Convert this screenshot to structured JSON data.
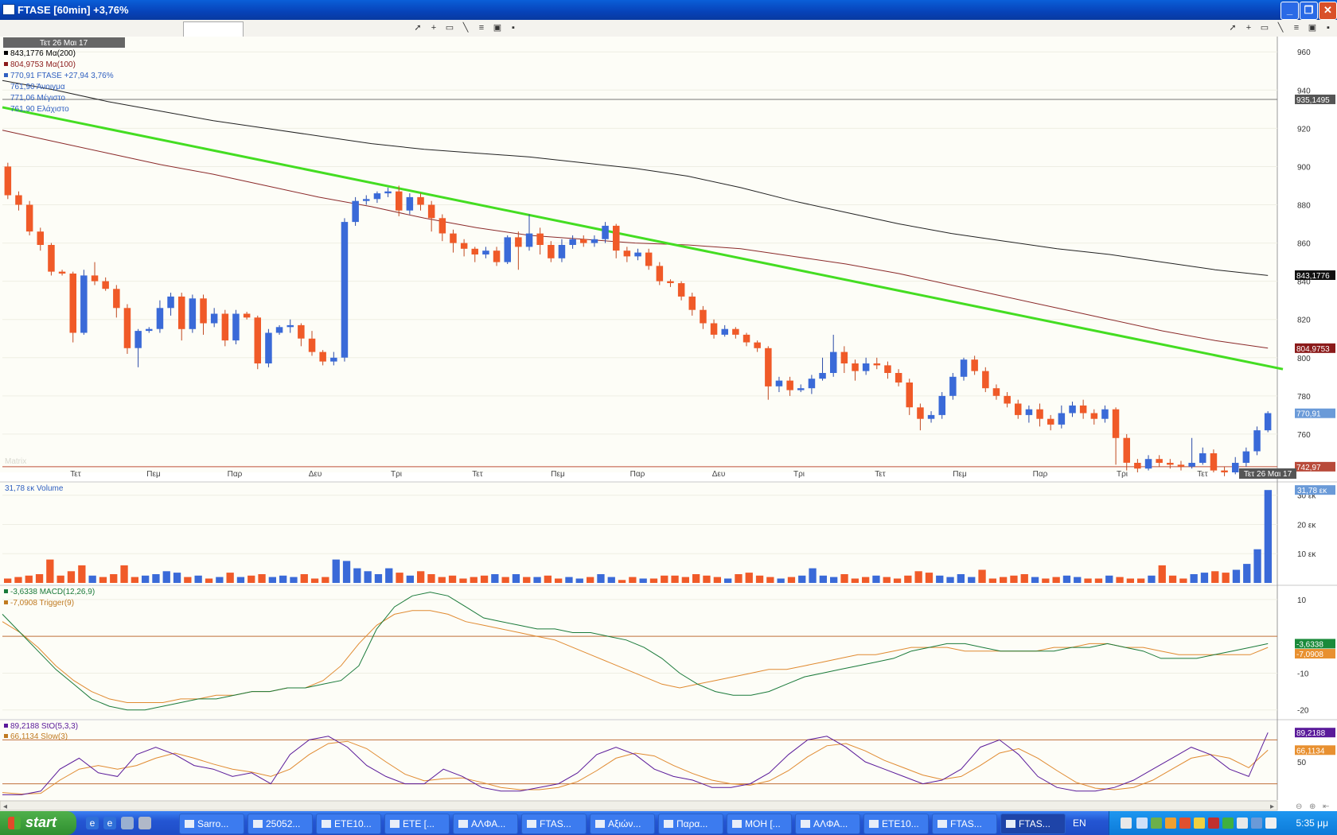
{
  "window": {
    "title": "FTASE [60min] +3,76%",
    "buttons": {
      "minimize": "_",
      "restore": "❐",
      "close": "✕"
    }
  },
  "toolbar": {
    "input_value": ""
  },
  "price_panel": {
    "date_label": "Τετ 26 Μαι 17",
    "legend": [
      {
        "text": "843,1776 Μα(200)",
        "color": "#000000"
      },
      {
        "text": "804,9753 Μα(100)",
        "color": "#8b1a1a"
      },
      {
        "text": "770,91 FTASE +27,94 3,76%",
        "color": "#3060c0"
      },
      {
        "text": "761,90 Άνοιγμα",
        "color": "#3060c0"
      },
      {
        "text": "771,06 Μέγιστο",
        "color": "#3060c0"
      },
      {
        "text": "761,90 Ελάχιστο",
        "color": "#3060c0"
      }
    ],
    "watermark": "Matrix"
  },
  "volume_panel": {
    "legend": "31,78 εκ Volume",
    "badge": "31,78 εκ"
  },
  "macd_panel": {
    "legend": [
      {
        "text": "-3,6338 MACD(12,26,9)",
        "color": "#1a7a3a"
      },
      {
        "text": "-7,0908 Trigger(9)",
        "color": "#c07a20"
      }
    ],
    "badges": [
      "-3,6338",
      "-7,0908"
    ]
  },
  "stoch_panel": {
    "legend": [
      {
        "text": "89,2188 StO(5,3,3)",
        "color": "#5a1a9a"
      },
      {
        "text": "66,1134 Slow(3)",
        "color": "#c07a20"
      }
    ],
    "badges": [
      "89,2188",
      "66,1134"
    ]
  },
  "chart_data": [
    {
      "type": "candlestick",
      "name": "FTASE [60min]",
      "x_ticks": [
        "Τετ",
        "Πεμ",
        "Παρ",
        "Δευ",
        "Τρι",
        "Τετ",
        "Πεμ",
        "Παρ",
        "Δευ",
        "Τρι",
        "Τετ",
        "Πεμ",
        "Παρ",
        "Τρι",
        "Τετ",
        "Τετ 26 Μαι 17"
      ],
      "y_ticks": [
        760,
        780,
        800,
        820,
        840,
        860,
        880,
        900,
        920,
        940,
        960
      ],
      "ylim": [
        740,
        968
      ],
      "price_badges": [
        {
          "text": "935,1495",
          "value": 935.15,
          "bg": "#555555",
          "fg": "#ffffff"
        },
        {
          "text": "843,1776",
          "value": 843.18,
          "bg": "#111111",
          "fg": "#ffffff"
        },
        {
          "text": "804,9753",
          "value": 804.98,
          "bg": "#8b1a1a",
          "fg": "#ffffff"
        },
        {
          "text": "770,91",
          "value": 770.91,
          "bg": "#6a9ad8",
          "fg": "#ffffff"
        },
        {
          "text": "742,97",
          "value": 742.97,
          "bg": "#b84a3a",
          "fg": "#ffffff"
        }
      ],
      "horizontal_lines": [
        935.15,
        742.97
      ],
      "trendline": {
        "color": "#44dd22",
        "from": 931,
        "to": 794
      },
      "ma200": [
        945,
        940,
        934,
        929,
        924,
        920,
        916,
        912,
        909,
        907,
        905,
        902,
        899,
        895,
        889,
        882,
        876,
        870,
        865,
        861,
        857,
        854,
        850,
        846,
        843
      ],
      "ma100": [
        919,
        913,
        907,
        901,
        896,
        890,
        884,
        879,
        873,
        868,
        864,
        862,
        860,
        859,
        857,
        853,
        849,
        844,
        838,
        832,
        826,
        820,
        814,
        809,
        805
      ],
      "candles": [
        [
          900,
          885,
          902,
          883
        ],
        [
          885,
          880,
          887,
          877
        ],
        [
          880,
          866,
          882,
          864
        ],
        [
          866,
          859,
          868,
          856
        ],
        [
          859,
          845,
          860,
          843
        ],
        [
          845,
          844,
          846,
          843
        ],
        [
          844,
          813,
          845,
          808
        ],
        [
          813,
          843,
          846,
          812
        ],
        [
          843,
          840,
          850,
          838
        ],
        [
          840,
          836,
          842,
          835
        ],
        [
          836,
          826,
          838,
          821
        ],
        [
          826,
          805,
          828,
          802
        ],
        [
          805,
          814,
          815,
          795
        ],
        [
          814,
          815,
          816,
          813
        ],
        [
          815,
          826,
          830,
          813
        ],
        [
          826,
          832,
          834,
          822
        ],
        [
          832,
          815,
          834,
          809
        ],
        [
          815,
          831,
          833,
          813
        ],
        [
          831,
          818,
          833,
          812
        ],
        [
          818,
          823,
          826,
          816
        ],
        [
          823,
          809,
          825,
          806
        ],
        [
          809,
          823,
          825,
          807
        ],
        [
          823,
          821,
          824,
          820
        ],
        [
          821,
          797,
          822,
          794
        ],
        [
          797,
          813,
          815,
          795
        ],
        [
          813,
          816,
          817,
          812
        ],
        [
          816,
          817,
          820,
          813
        ],
        [
          817,
          810,
          818,
          806
        ],
        [
          810,
          803,
          814,
          801
        ],
        [
          803,
          798,
          804,
          796
        ],
        [
          798,
          800,
          803,
          796
        ],
        [
          800,
          871,
          873,
          798
        ],
        [
          871,
          882,
          884,
          869
        ],
        [
          882,
          883,
          885,
          880
        ],
        [
          883,
          886,
          887,
          881
        ],
        [
          886,
          887,
          889,
          884
        ],
        [
          887,
          877,
          890,
          874
        ],
        [
          877,
          884,
          886,
          875
        ],
        [
          884,
          880,
          886,
          877
        ],
        [
          880,
          873,
          882,
          866
        ],
        [
          873,
          865,
          875,
          861
        ],
        [
          865,
          860,
          867,
          855
        ],
        [
          860,
          857,
          862,
          853
        ],
        [
          857,
          854,
          858,
          850
        ],
        [
          854,
          856,
          858,
          852
        ],
        [
          856,
          850,
          858,
          848
        ],
        [
          850,
          863,
          864,
          849
        ],
        [
          863,
          858,
          866,
          846
        ],
        [
          858,
          865,
          875,
          856
        ],
        [
          865,
          859,
          868,
          854
        ],
        [
          859,
          852,
          861,
          850
        ],
        [
          852,
          859,
          862,
          850
        ],
        [
          859,
          862,
          864,
          857
        ],
        [
          862,
          860,
          864,
          858
        ],
        [
          860,
          862,
          864,
          858
        ],
        [
          862,
          869,
          871,
          860
        ],
        [
          869,
          856,
          870,
          852
        ],
        [
          856,
          853,
          858,
          850
        ],
        [
          853,
          855,
          857,
          851
        ],
        [
          855,
          848,
          857,
          846
        ],
        [
          848,
          840,
          850,
          838
        ],
        [
          840,
          839,
          841,
          837
        ],
        [
          839,
          832,
          840,
          830
        ],
        [
          832,
          825,
          834,
          822
        ],
        [
          825,
          818,
          827,
          815
        ],
        [
          818,
          812,
          820,
          810
        ],
        [
          812,
          815,
          817,
          811
        ],
        [
          815,
          812,
          816,
          810
        ],
        [
          812,
          808,
          813,
          806
        ],
        [
          808,
          805,
          809,
          803
        ],
        [
          805,
          785,
          806,
          778
        ],
        [
          785,
          788,
          790,
          782
        ],
        [
          788,
          783,
          790,
          780
        ],
        [
          783,
          784,
          786,
          782
        ],
        [
          784,
          789,
          791,
          781
        ],
        [
          789,
          792,
          800,
          788
        ],
        [
          792,
          803,
          812,
          790
        ],
        [
          803,
          797,
          806,
          792
        ],
        [
          797,
          793,
          799,
          788
        ],
        [
          793,
          797,
          800,
          791
        ],
        [
          797,
          796,
          800,
          794
        ],
        [
          796,
          792,
          798,
          789
        ],
        [
          792,
          787,
          794,
          785
        ],
        [
          787,
          774,
          789,
          770
        ],
        [
          774,
          768,
          776,
          762
        ],
        [
          768,
          770,
          772,
          766
        ],
        [
          770,
          780,
          782,
          768
        ],
        [
          780,
          790,
          792,
          778
        ],
        [
          790,
          799,
          800,
          788
        ],
        [
          799,
          793,
          801,
          791
        ],
        [
          793,
          784,
          795,
          782
        ],
        [
          784,
          780,
          786,
          778
        ],
        [
          780,
          776,
          782,
          774
        ],
        [
          776,
          770,
          778,
          768
        ],
        [
          770,
          773,
          775,
          766
        ],
        [
          773,
          768,
          776,
          764
        ],
        [
          768,
          765,
          770,
          762
        ],
        [
          765,
          771,
          775,
          763
        ],
        [
          771,
          775,
          777,
          769
        ],
        [
          775,
          771,
          778,
          768
        ],
        [
          771,
          768,
          773,
          765
        ],
        [
          768,
          773,
          775,
          766
        ],
        [
          773,
          758,
          774,
          744
        ],
        [
          758,
          745,
          760,
          741
        ],
        [
          745,
          742,
          747,
          740
        ],
        [
          742,
          747,
          749,
          741
        ],
        [
          747,
          745,
          749,
          743
        ],
        [
          745,
          744,
          747,
          742
        ],
        [
          744,
          743,
          746,
          741
        ],
        [
          743,
          745,
          758,
          742
        ],
        [
          745,
          750,
          753,
          744
        ],
        [
          750,
          741,
          752,
          740
        ],
        [
          741,
          740,
          743,
          738
        ],
        [
          740,
          745,
          748,
          739
        ],
        [
          745,
          751,
          753,
          743
        ],
        [
          751,
          762,
          764,
          749
        ],
        [
          762,
          771,
          772,
          761
        ]
      ],
      "volume_ylim": [
        0,
        34
      ],
      "volume_ticks": [
        "10 εκ",
        "20 εκ",
        "30 εκ"
      ],
      "volume_values": [
        1.5,
        2,
        2.5,
        3,
        8,
        2.5,
        4,
        6,
        2.5,
        2,
        3,
        6,
        2,
        2.5,
        3,
        4,
        3.5,
        2,
        2.5,
        1.5,
        2,
        3.5,
        2,
        2.5,
        3,
        2,
        2.5,
        2,
        3,
        1.5,
        2,
        8,
        7.5,
        5,
        4,
        3,
        5,
        3.5,
        2.5,
        4,
        3,
        2,
        2.5,
        1.5,
        2,
        2.5,
        3,
        2,
        3,
        2,
        2,
        2.5,
        1.5,
        2,
        1.5,
        2,
        3,
        2,
        1,
        2,
        1.5,
        1.5,
        2.5,
        2.5,
        2,
        3,
        2.5,
        2,
        1.5,
        3,
        3.5,
        2.5,
        2,
        1.5,
        2,
        2.5,
        5,
        2.5,
        2,
        3,
        1.5,
        2,
        2.5,
        2,
        1.5,
        2.5,
        4,
        3.5,
        2.5,
        2,
        3,
        2,
        4.5,
        1.5,
        2,
        2.5,
        3,
        2,
        1.5,
        2,
        2.5,
        2,
        1.5,
        1.5,
        2.5,
        2,
        1.5,
        1.5,
        2.5,
        6,
        2.5,
        1.5,
        3,
        3.5,
        4,
        3.5,
        4.5,
        6.5,
        11.5,
        31.78
      ],
      "macd_ylim": [
        -22,
        13
      ],
      "macd_ticks": [
        10,
        -10,
        -20
      ],
      "macd_refline": 0,
      "macd": [
        6,
        1,
        -4,
        -9,
        -13,
        -17,
        -19,
        -20,
        -20,
        -19,
        -18,
        -17,
        -17,
        -16,
        -15,
        -15,
        -14,
        -14,
        -13,
        -12,
        -8,
        2,
        8,
        11,
        12,
        11,
        8,
        5,
        4,
        3,
        2,
        2,
        1,
        1,
        0,
        -1,
        -3,
        -6,
        -10,
        -13,
        -15,
        -16,
        -16,
        -15,
        -13,
        -11,
        -10,
        -9,
        -8,
        -7,
        -6,
        -4,
        -3,
        -2,
        -2,
        -3,
        -4,
        -4,
        -4,
        -4,
        -3,
        -3,
        -2,
        -3,
        -4,
        -6,
        -6,
        -6,
        -5,
        -4,
        -3,
        -2
      ],
      "trigger": [
        4,
        1,
        -3,
        -8,
        -12,
        -15,
        -17,
        -18,
        -18,
        -18,
        -17,
        -17,
        -16,
        -16,
        -15,
        -15,
        -14,
        -14,
        -12,
        -8,
        -2,
        3,
        6,
        7,
        7,
        6,
        4,
        3,
        2,
        1,
        0,
        -1,
        -3,
        -5,
        -7,
        -9,
        -11,
        -13,
        -14,
        -13,
        -12,
        -11,
        -10,
        -9,
        -9,
        -8,
        -7,
        -6,
        -5,
        -5,
        -4,
        -3,
        -3,
        -3,
        -4,
        -4,
        -4,
        -4,
        -4,
        -3,
        -3,
        -2,
        -2,
        -3,
        -3,
        -4,
        -5,
        -5,
        -5,
        -5,
        -5,
        -3
      ],
      "stoch_ylim": [
        0,
        100
      ],
      "stoch_ticks": [
        50
      ],
      "stoch_reflines": [
        80,
        20
      ],
      "stoch": [
        5,
        5,
        10,
        40,
        55,
        35,
        30,
        60,
        70,
        60,
        45,
        40,
        30,
        35,
        20,
        60,
        80,
        85,
        70,
        45,
        30,
        20,
        20,
        40,
        30,
        15,
        10,
        10,
        15,
        20,
        35,
        60,
        70,
        60,
        40,
        30,
        25,
        15,
        15,
        20,
        35,
        60,
        80,
        85,
        70,
        50,
        40,
        30,
        20,
        25,
        40,
        70,
        80,
        60,
        30,
        15,
        10,
        10,
        15,
        25,
        40,
        55,
        70,
        60,
        40,
        30,
        90
      ],
      "slow": [
        8,
        6,
        7,
        25,
        40,
        45,
        40,
        45,
        55,
        62,
        55,
        47,
        40,
        36,
        30,
        40,
        60,
        75,
        78,
        68,
        50,
        33,
        24,
        27,
        28,
        22,
        15,
        12,
        12,
        15,
        23,
        38,
        55,
        62,
        58,
        45,
        34,
        25,
        20,
        18,
        24,
        38,
        57,
        72,
        75,
        65,
        52,
        42,
        32,
        26,
        30,
        45,
        62,
        68,
        55,
        38,
        22,
        14,
        12,
        15,
        25,
        40,
        55,
        60,
        55,
        42,
        66
      ]
    }
  ],
  "taskbar": {
    "start_label": "start",
    "tasks": [
      "Sarro...",
      "25052...",
      "ETE10...",
      "ETE [...",
      "ΑΛΦΑ...",
      "FTAS...",
      "Αξιών...",
      "Παρα...",
      "MOH [...",
      "ΑΛΦΑ...",
      "ETE10...",
      "FTAS...",
      "FTAS..."
    ],
    "language": "EN",
    "clock": "5:35 μμ"
  }
}
